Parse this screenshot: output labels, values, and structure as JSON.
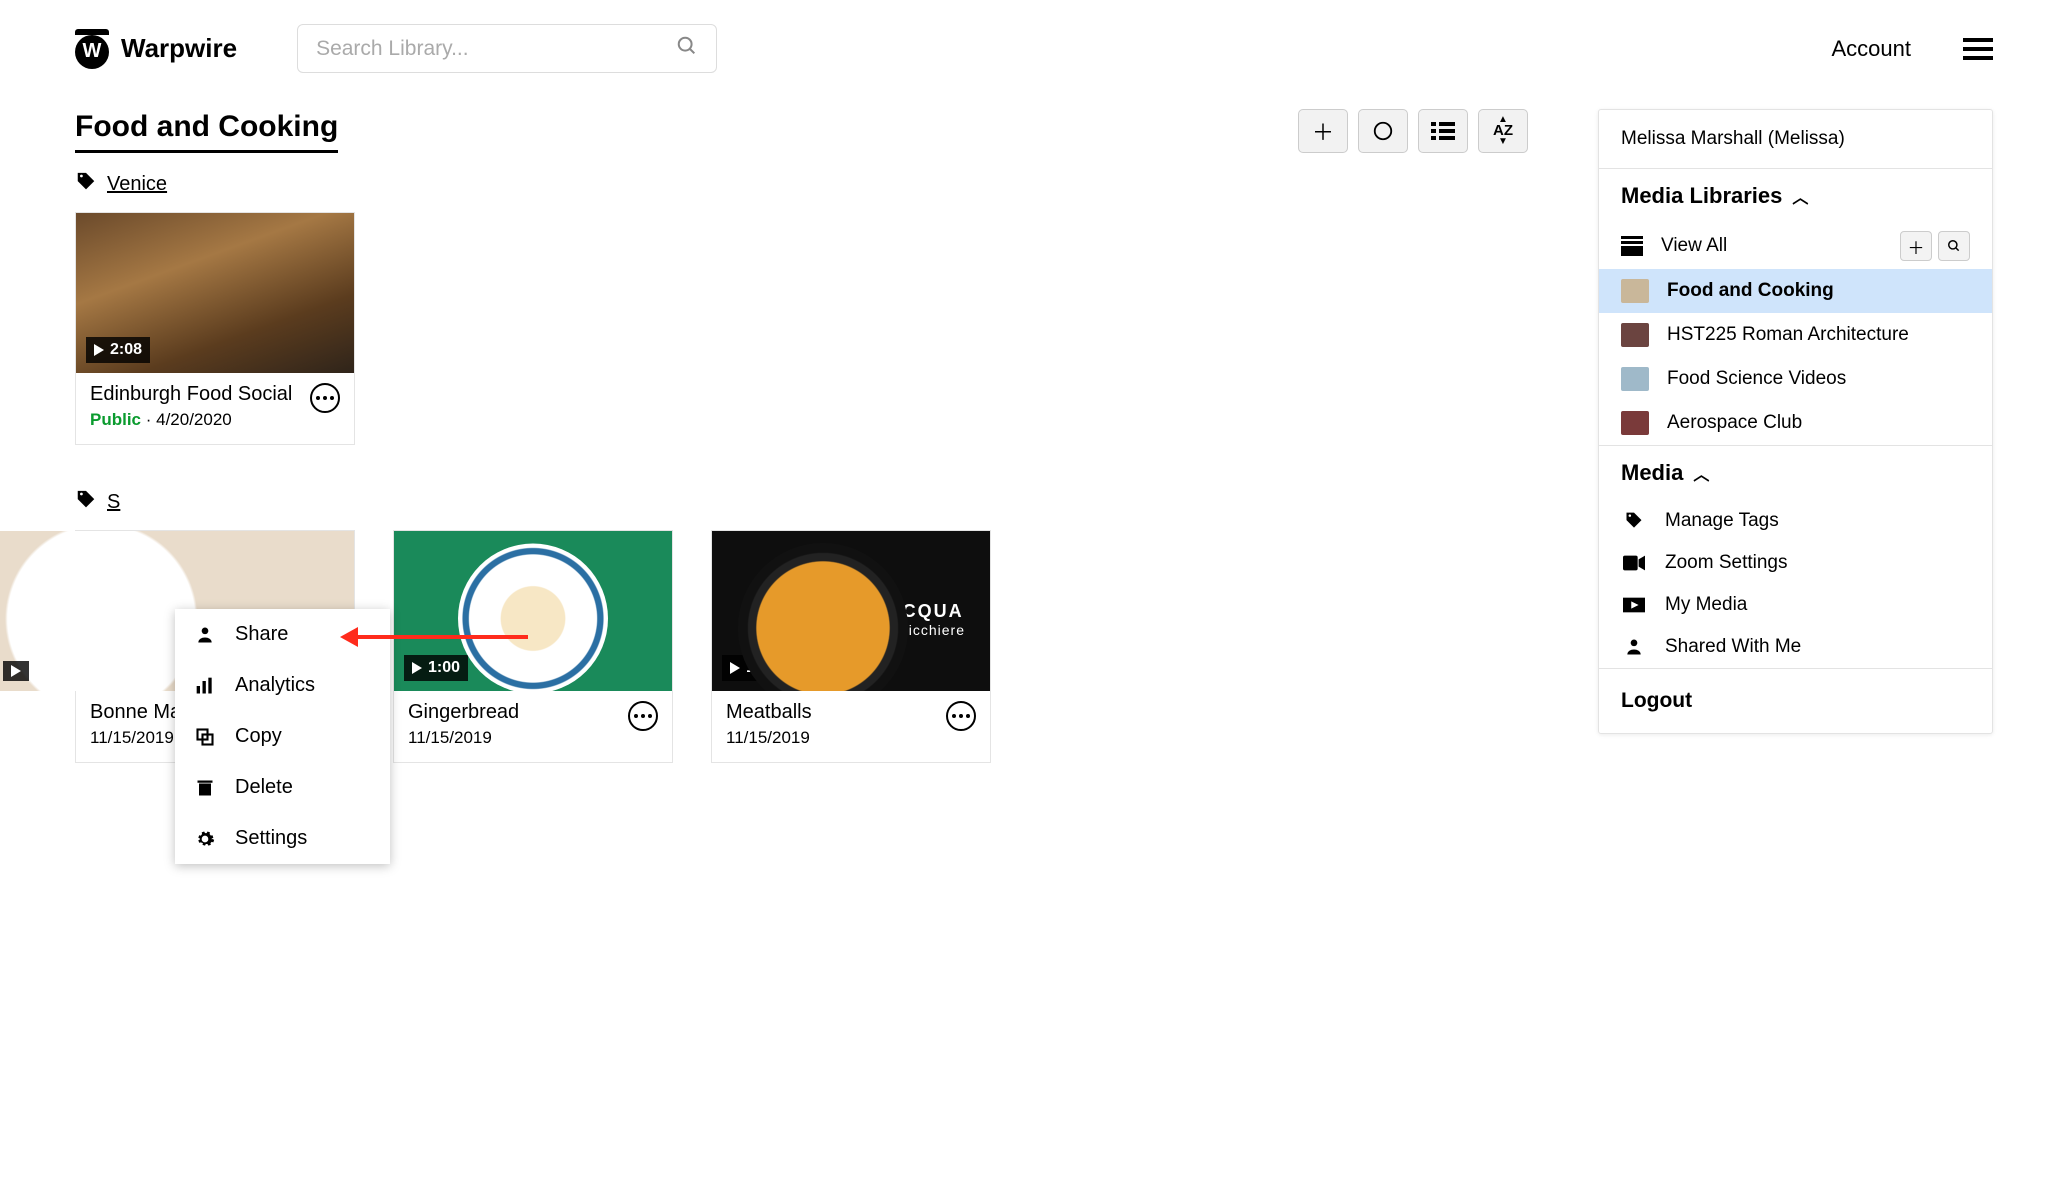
{
  "brand": "Warpwire",
  "search": {
    "placeholder": "Search Library..."
  },
  "account_label": "Account",
  "library": {
    "title": "Food and Cooking",
    "tags": [
      {
        "label": "Venice"
      }
    ],
    "second_tag_visible_letter": "S"
  },
  "cards": [
    {
      "title": "Edinburgh Food Social",
      "duration": "2:08",
      "date": "4/20/2020",
      "visibility": "Public",
      "thumb_class": "market"
    },
    {
      "title": "Bonne Maman Blueb…",
      "duration": "",
      "date": "11/15/2019",
      "thumb_class": "bonne"
    },
    {
      "title": "Gingerbread",
      "duration": "1:00",
      "date": "11/15/2019",
      "thumb_class": "ginger"
    },
    {
      "title": "Meatballs",
      "duration": "1:00",
      "date": "11/15/2019",
      "thumb_class": "meat",
      "overlay": "ACQUA",
      "overlay_sub": "1 bicchiere"
    }
  ],
  "context_menu": {
    "items": [
      {
        "label": "Share",
        "icon": "person"
      },
      {
        "label": "Analytics",
        "icon": "bars"
      },
      {
        "label": "Copy",
        "icon": "copy"
      },
      {
        "label": "Delete",
        "icon": "trash"
      },
      {
        "label": "Settings",
        "icon": "gear"
      }
    ]
  },
  "sidebar": {
    "user": "Melissa Marshall (Melissa)",
    "libraries_header": "Media Libraries",
    "view_all": "View All",
    "libraries": [
      {
        "label": "Food and Cooking",
        "active": true,
        "color": "#c9b79a"
      },
      {
        "label": "HST225 Roman Architecture",
        "color": "#6b4440"
      },
      {
        "label": "Food Science Videos",
        "color": "#9fb9c9"
      },
      {
        "label": "Aerospace Club",
        "color": "#7a3a3a"
      }
    ],
    "media_header": "Media",
    "media_items": [
      {
        "label": "Manage Tags",
        "icon": "tag"
      },
      {
        "label": "Zoom Settings",
        "icon": "video"
      },
      {
        "label": "My Media",
        "icon": "play"
      },
      {
        "label": "Shared With Me",
        "icon": "person"
      }
    ],
    "logout": "Logout"
  }
}
